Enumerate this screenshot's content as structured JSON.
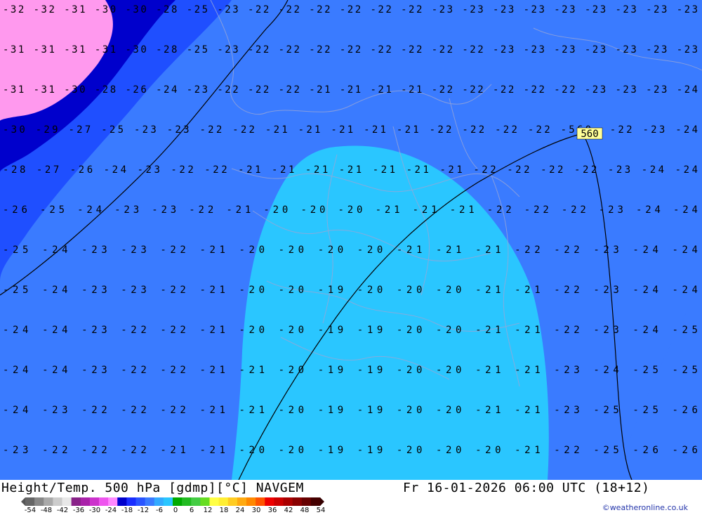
{
  "map": {
    "contour_labels": [
      {
        "row": "-32 -32 -31 -30 -30 -28 -25 -23 -22 -22 -22 -22 -22 -22 -23 -23 -23 -23 -23 -23 -23 -23 -23"
      },
      {
        "row": "-31 -31 -31 -31 -30 -28 -25 -23 -22 -22 -22 -22 -22 -22 -22 -22 -23 -23 -23 -23 -23 -23 -23"
      },
      {
        "row": "-31 -31 -30 -28 -26 -24 -23 -22 -22 -22 -21 -21 -21 -21 -22 -22 -22 -22 -22 -23 -23 -23 -24"
      },
      {
        "row": "-30 -29 -27 -25 -23 -23 -22 -22 -21 -21 -21 -21 -21 -22 -22 -22 -22 -560- -22 -23 -24"
      },
      {
        "row": "-28 -27 -26 -24 -23 -22 -22 -21 -21 -21 -21 -21 -21 -21 -22 -22 -22 -22 -23 -24 -24"
      },
      {
        "row": "-26 -25 -24 -23 -23 -22 -21 -20 -20 -20 -21 -21 -21 -22 -22 -22 -23 -24 -24"
      },
      {
        "row": "-25 -24 -23 -23 -22 -21 -20 -20 -20 -20 -21 -21 -21 -22 -22 -23 -24 -24"
      },
      {
        "row": "-25 -24 -23 -23 -22 -21 -20 -20 -19 -20 -20 -20 -21 -21 -22 -23 -24 -24"
      },
      {
        "row": "-24 -24 -23 -22 -22 -21 -20 -20 -19 -19 -20 -20 -21 -21 -22 -23 -24 -25"
      },
      {
        "row": "-24 -24 -23 -22 -22 -21 -21 -20 -19 -19 -20 -20 -21 -21 -23 -24 -25 -25"
      },
      {
        "row": "-24 -23 -22 -22 -22 -21 -21 -20 -19 -19 -20 -20 -21 -21 -23 -25 -25 -26"
      },
      {
        "row": "-23 -22 -22 -22 -21 -21 -20 -20 -19 -19 -20 -20 -20 -21 -22 -25 -26 -26"
      }
    ],
    "height_label": "560",
    "colors": {
      "pink": "#ff99ee",
      "dark_blue": "#0000cc",
      "mid_blue": "#1f4fff",
      "blue": "#3a7bff",
      "light_blue": "#2ac6ff"
    }
  },
  "footer": {
    "title": "Height/Temp. 500 hPa [gdmp][°C] NAVGEM",
    "valid_time": "Fr 16-01-2026 06:00 UTC (18+12)",
    "credit": "©weatheronline.co.uk",
    "scale_ticks": [
      "-54",
      "-48",
      "-42",
      "-36",
      "-30",
      "-24",
      "-18",
      "-12",
      "-6",
      "0",
      "6",
      "12",
      "18",
      "24",
      "30",
      "36",
      "42",
      "48",
      "54"
    ],
    "scale_colors": [
      "#666666",
      "#888888",
      "#aaaaaa",
      "#cccccc",
      "#e8e8e8",
      "#882288",
      "#aa22aa",
      "#cc33cc",
      "#ee55ee",
      "#ff88ff",
      "#0000cc",
      "#1a2eff",
      "#2a55ff",
      "#3a7bff",
      "#33aaff",
      "#2ac6ff",
      "#00aa00",
      "#22bb22",
      "#44cc44",
      "#66dd22",
      "#ffff44",
      "#ffee33",
      "#ffcc22",
      "#ffaa11",
      "#ff8800",
      "#ff5500",
      "#ee0000",
      "#cc0000",
      "#aa0000",
      "#880000",
      "#660000",
      "#440000"
    ]
  }
}
